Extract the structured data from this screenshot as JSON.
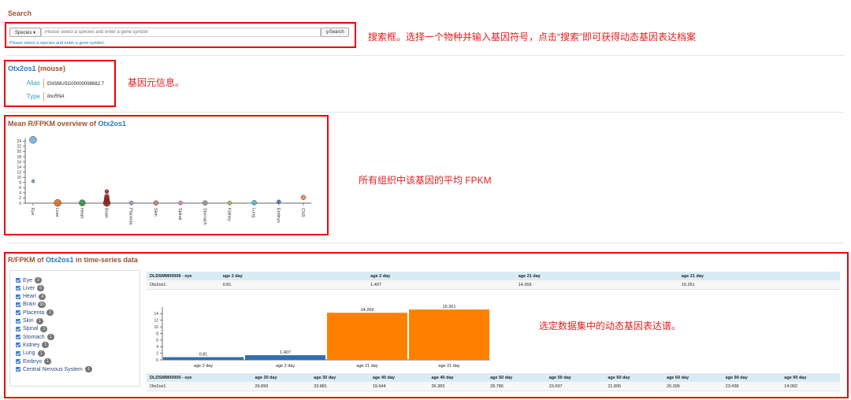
{
  "search": {
    "heading": "Search",
    "species_button": "Species ▾",
    "placeholder": "Please select a species and enter a gene symbol",
    "search_button": "Search",
    "hint": "Please select a species and enter a gene symbol.",
    "annotation": "搜索框。选择一个物种并输入基因符号，点击“搜索”即可获得动态基因表达档案"
  },
  "gene": {
    "symbol": "Otx2os1",
    "species": "(mouse)",
    "alias_label": "Alias",
    "alias_value": "ENSMUSG00000098682.7",
    "type_label": "Type",
    "type_value": "lincRNA",
    "annotation": "基因元信息。"
  },
  "overview": {
    "title_prefix": "Mean R/FPKM overview of ",
    "gene": "Otx2os1",
    "annotation": "所有组织中该基因的平均 FPKM"
  },
  "timeseries": {
    "title_prefix": "R/FPKM of ",
    "gene": "Otx2os1",
    "title_suffix": " in time-series data",
    "annotation": "选定数据集中的动态基因表达谱。",
    "tissues": [
      {
        "name": "Eye",
        "count": "2"
      },
      {
        "name": "Liver",
        "count": "6"
      },
      {
        "name": "Heart",
        "count": "4"
      },
      {
        "name": "Brain",
        "count": "16"
      },
      {
        "name": "Placenta",
        "count": "1"
      },
      {
        "name": "Skin",
        "count": "1"
      },
      {
        "name": "Spinal",
        "count": "1"
      },
      {
        "name": "Stomach",
        "count": "1"
      },
      {
        "name": "Kidney",
        "count": "1"
      },
      {
        "name": "Lung",
        "count": "1"
      },
      {
        "name": "Embryo",
        "count": "1"
      },
      {
        "name": "Central Nervous System",
        "count": "1"
      }
    ],
    "table1": {
      "header": [
        "DLDSMM00008 - eye",
        "age 2 day",
        "age 2 day",
        "age 21 day",
        "age 21 day"
      ],
      "row": [
        "Otx2os1",
        "0.81",
        "1.407",
        "14.269",
        "15.261"
      ]
    },
    "table2": {
      "header": [
        "DLDSMM00009 - eye",
        "age 30 day",
        "age 30 day",
        "age 40 day",
        "age 40 day",
        "age 50 day",
        "age 50 day",
        "age 60 day",
        "age 60 day",
        "age 90 day",
        "age 90 day"
      ],
      "row": [
        "Otx2os1",
        "26.899",
        "33.881",
        "19.644",
        "26.383",
        "28.786",
        "23.697",
        "21.805",
        "26.306",
        "23.438",
        "14.002"
      ]
    }
  },
  "chart_data": [
    {
      "type": "scatter",
      "title": "Mean R/FPKM overview of Otx2os1",
      "categories": [
        "Eye",
        "Liver",
        "Heart",
        "Brain",
        "Placenta",
        "Skin",
        "Spinal",
        "Stomach",
        "Kidney",
        "Lung",
        "Embryo",
        "CNS"
      ],
      "colors": [
        "#6fa8dc",
        "#d2691e",
        "#2e8b3a",
        "#a01818",
        "#b48bd0",
        "#c08070",
        "#e080c0",
        "#909090",
        "#b8b840",
        "#40b8c8",
        "#3a6ab8",
        "#f08040"
      ],
      "points": [
        {
          "category": "Eye",
          "y": 24.5,
          "size": 7
        },
        {
          "category": "Eye",
          "y": 8.5,
          "size": 2
        },
        {
          "category": "Liver",
          "y": 0.1,
          "size": 7
        },
        {
          "category": "Heart",
          "y": 0.1,
          "size": 6
        },
        {
          "category": "Brain",
          "y": 0.1,
          "size": 7
        },
        {
          "category": "Brain",
          "y": 0.8,
          "size": 5
        },
        {
          "category": "Brain",
          "y": 1.6,
          "size": 5
        },
        {
          "category": "Brain",
          "y": 2.6,
          "size": 4
        },
        {
          "category": "Brain",
          "y": 4.5,
          "size": 3
        },
        {
          "category": "Placenta",
          "y": 0.1,
          "size": 3
        },
        {
          "category": "Skin",
          "y": 0.1,
          "size": 4
        },
        {
          "category": "Spinal",
          "y": 0.1,
          "size": 3
        },
        {
          "category": "Stomach",
          "y": 0.1,
          "size": 4
        },
        {
          "category": "Kidney",
          "y": 0.1,
          "size": 3
        },
        {
          "category": "Lung",
          "y": 0.2,
          "size": 4
        },
        {
          "category": "Embryo",
          "y": 0.5,
          "size": 3
        },
        {
          "category": "CNS",
          "y": 2.2,
          "size": 4
        }
      ],
      "yticks": [
        0,
        2,
        4,
        6,
        8,
        10,
        12,
        14,
        16,
        18,
        20,
        22,
        24
      ],
      "ylim": [
        0,
        25
      ]
    },
    {
      "type": "bar",
      "categories": [
        "age 2 day",
        "age 2 day",
        "age 21 day",
        "age 21 day"
      ],
      "values": [
        0.81,
        1.407,
        14.269,
        15.261
      ],
      "labels": [
        "0.81",
        "1.407",
        "14.269",
        "15.261"
      ],
      "colors": [
        "#2f6fb0",
        "#2f6fb0",
        "#ff8000",
        "#ff8000"
      ],
      "yticks": [
        0,
        2,
        4,
        6,
        8,
        10,
        12,
        14
      ],
      "ylim": [
        0,
        16
      ]
    }
  ]
}
